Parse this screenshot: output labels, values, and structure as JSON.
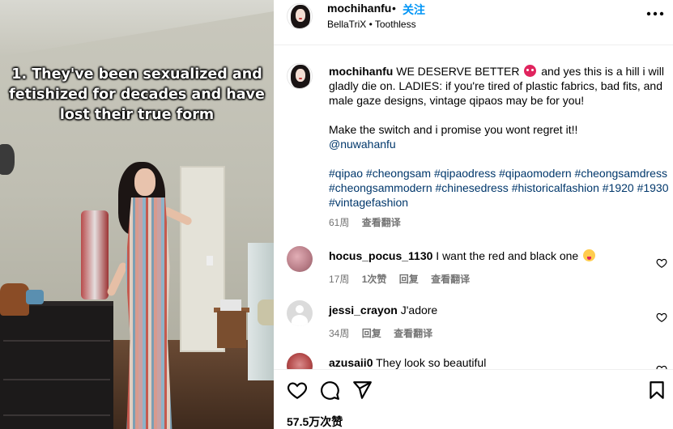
{
  "media": {
    "caption": "1. They've been sexualized and fetishized for decades and have lost their true form"
  },
  "header": {
    "username": "mochihanfu",
    "separator": "•",
    "follow_label": "关注",
    "audio": "BellaTriX • Toothless",
    "more_icon": "more-horizontal-icon"
  },
  "post": {
    "username": "mochihanfu",
    "text_before_emoji": "WE DESERVE BETTER",
    "emoji": "angry-face-emoji",
    "text_after_emoji": "and yes this is a hill i will gladly die on. LADIES: if you're tired of plastic fabrics, bad fits, and male gaze designs, vintage qipaos may be for you!",
    "para2": "Make the switch and i promise you wont regret it!!",
    "mention": "@nuwahanfu",
    "hashtags": "#qipao #cheongsam #qipaodress #qipaomodern #cheongsamdress #cheongsammodern #chinesedress #historicalfashion #1920 #1930 #vintagefashion",
    "age": "61周",
    "translate": "查看翻译"
  },
  "comments": [
    {
      "username": "hocus_pocus_1130",
      "text": "I want the red and black one",
      "emoji": "yum-face-emoji",
      "age": "17周",
      "likes": "1次赞",
      "reply": "回复",
      "translate": "查看翻译"
    },
    {
      "username": "jessi_crayon",
      "text": "J'adore",
      "age": "34周",
      "reply": "回复",
      "translate": "查看翻译"
    },
    {
      "username": "azusaii0",
      "text": "They look so beautiful"
    }
  ],
  "footer": {
    "like_icon": "heart-icon",
    "comment_icon": "comment-icon",
    "share_icon": "send-icon",
    "save_icon": "bookmark-icon",
    "likes": "57.5万次赞"
  }
}
